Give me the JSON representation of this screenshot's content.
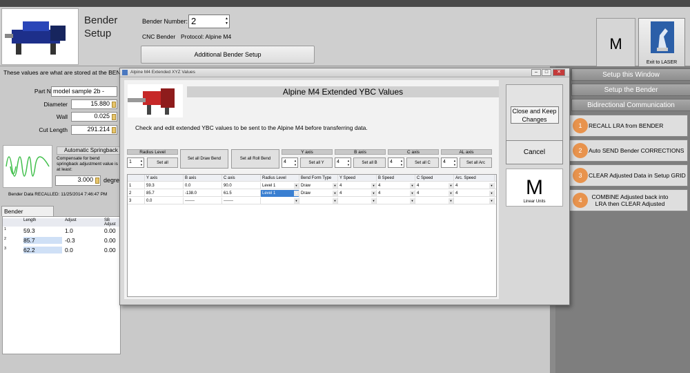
{
  "header": {
    "title_line1": "Bender",
    "title_line2": "Setup",
    "bender_number_label": "Bender Number:",
    "bender_number_value": "2",
    "cnc_label": "CNC Bender",
    "protocol_label": "Protocol:  Alpine M4",
    "additional_setup_label": "Additional Bender Setup",
    "units": "M",
    "exit_label": "Exit to LASER"
  },
  "left": {
    "info_text": "These values are what are stored at the BENDER",
    "part_number_label": "Part Number",
    "part_number_value": "model sample 2b -",
    "diameter_label": "Diameter",
    "diameter_value": "15.880",
    "wall_label": "Wall",
    "wall_value": "0.025",
    "cut_length_label": "Cut Length",
    "cut_length_value": "291.214",
    "auto_springback_label": "Automatic Springback",
    "compensate_text": "Compensate for bend springback adjustment value is at least:",
    "springback_value": "3.000",
    "degrees_label": "degrees",
    "recalled_label": "Bender Data RECALLED:  11/25/2014 7:46:47 PM",
    "tab_label": "Bender Adjustment",
    "adj_headers": [
      "Length",
      "Adjust",
      "SB Adjust"
    ],
    "adj_rows": [
      {
        "num": "1",
        "length": "59.3",
        "adjust": "1.0",
        "sb": "0.00"
      },
      {
        "num": "2",
        "length": "85.7",
        "adjust": "-0.3",
        "sb": "0.00"
      },
      {
        "num": "3",
        "length": "62.2",
        "adjust": "0.0",
        "sb": "0.00"
      }
    ]
  },
  "sidebar": {
    "headers": [
      "Setup this Window",
      "Setup the Bender",
      "Bidirectional Communication"
    ],
    "actions": [
      {
        "num": "1",
        "label": "RECALL LRA from BENDER"
      },
      {
        "num": "2",
        "label": "Auto SEND Bender CORRECTIONS"
      },
      {
        "num": "3",
        "label": "CLEAR Adjusted Data in Setup GRID"
      },
      {
        "num": "4",
        "label": "COMBINE Adjusted back into LRA then CLEAR Adjusted"
      }
    ]
  },
  "dialog": {
    "window_title": "Alpine M4 Extended XYZ Values",
    "heading": "Alpine M4 Extended YBC Values",
    "instruction": "Check and edit extended YBC values to be sent to the Alpine M4 before transferring data.",
    "close_keep_label": "Close and Keep Changes",
    "cancel_label": "Cancel",
    "units": "M",
    "units_label": "Linear Units",
    "groups": {
      "radius_level": {
        "label": "Radius Level",
        "value": "1",
        "button": "Set all"
      },
      "draw_bend": {
        "button": "Set all Draw Bend"
      },
      "roll_bend": {
        "button": "Set all Roll Bend"
      },
      "y_axis": {
        "label": "Y axis",
        "value": "4",
        "button": "Set all Y"
      },
      "b_axis": {
        "label": "B axis",
        "value": "4",
        "button": "Set all B"
      },
      "c_axis": {
        "label": "C axis",
        "value": "4",
        "button": "Set all C"
      },
      "al_axis": {
        "label": "AL axis",
        "value": "4",
        "button": "Set all Arc"
      }
    },
    "grid_headers": [
      "Y axis",
      "B axis",
      "C axis",
      "Radius Level",
      "Bend Form Type",
      "Y Speed",
      "B Speed",
      "C Speed",
      "Arc. Speed"
    ],
    "grid_rows": [
      {
        "num": "1",
        "cells": [
          "59.3",
          "0.0",
          "90.0",
          "Level 1",
          "Draw",
          "4",
          "4",
          "4",
          "4"
        ]
      },
      {
        "num": "2",
        "cells": [
          "85.7",
          "-138.0",
          "61.5",
          "Level 1",
          "Draw",
          "4",
          "4",
          "4",
          "4"
        ]
      },
      {
        "num": "3",
        "cells": [
          "0.0",
          "-------",
          "-------",
          "",
          "",
          "",
          "",
          "",
          ""
        ]
      }
    ]
  },
  "colors": {
    "sidebar_bg": "#7e7e7e",
    "accent_orange": "#e8934d",
    "selection_blue": "#3a7fd1"
  }
}
